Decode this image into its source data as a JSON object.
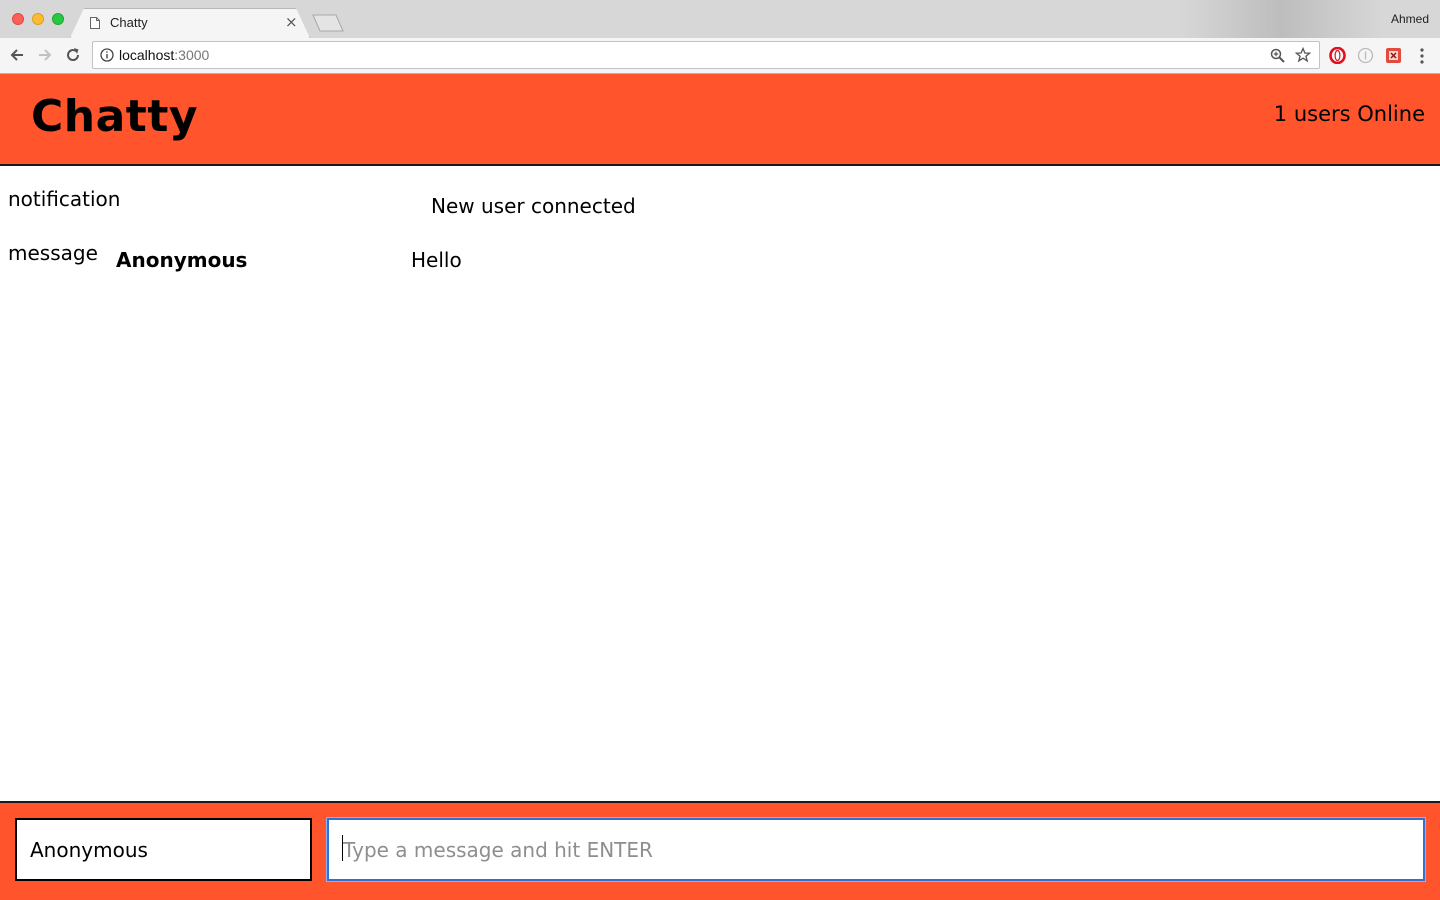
{
  "browser": {
    "tab_title": "Chatty",
    "tab_close": "×",
    "profile_name": "Ahmed",
    "url_host": "localhost",
    "url_port": ":3000"
  },
  "navbar": {
    "brand": "Chatty",
    "online_count": "1 users Online",
    "color": "#ff542c"
  },
  "messages": [
    {
      "type": "notification",
      "username": "",
      "content": "New user connected"
    },
    {
      "type": "message",
      "username": "Anonymous",
      "content": "Hello"
    }
  ],
  "footer": {
    "username_value": "Anonymous",
    "message_placeholder": "Type a message and hit ENTER",
    "message_value": ""
  },
  "icons": [
    "info-icon",
    "zoom-icon",
    "star-icon",
    "back-arrow-icon",
    "forward-arrow-icon",
    "reload-icon",
    "opera-icon",
    "extension-icon",
    "menu-icon"
  ]
}
